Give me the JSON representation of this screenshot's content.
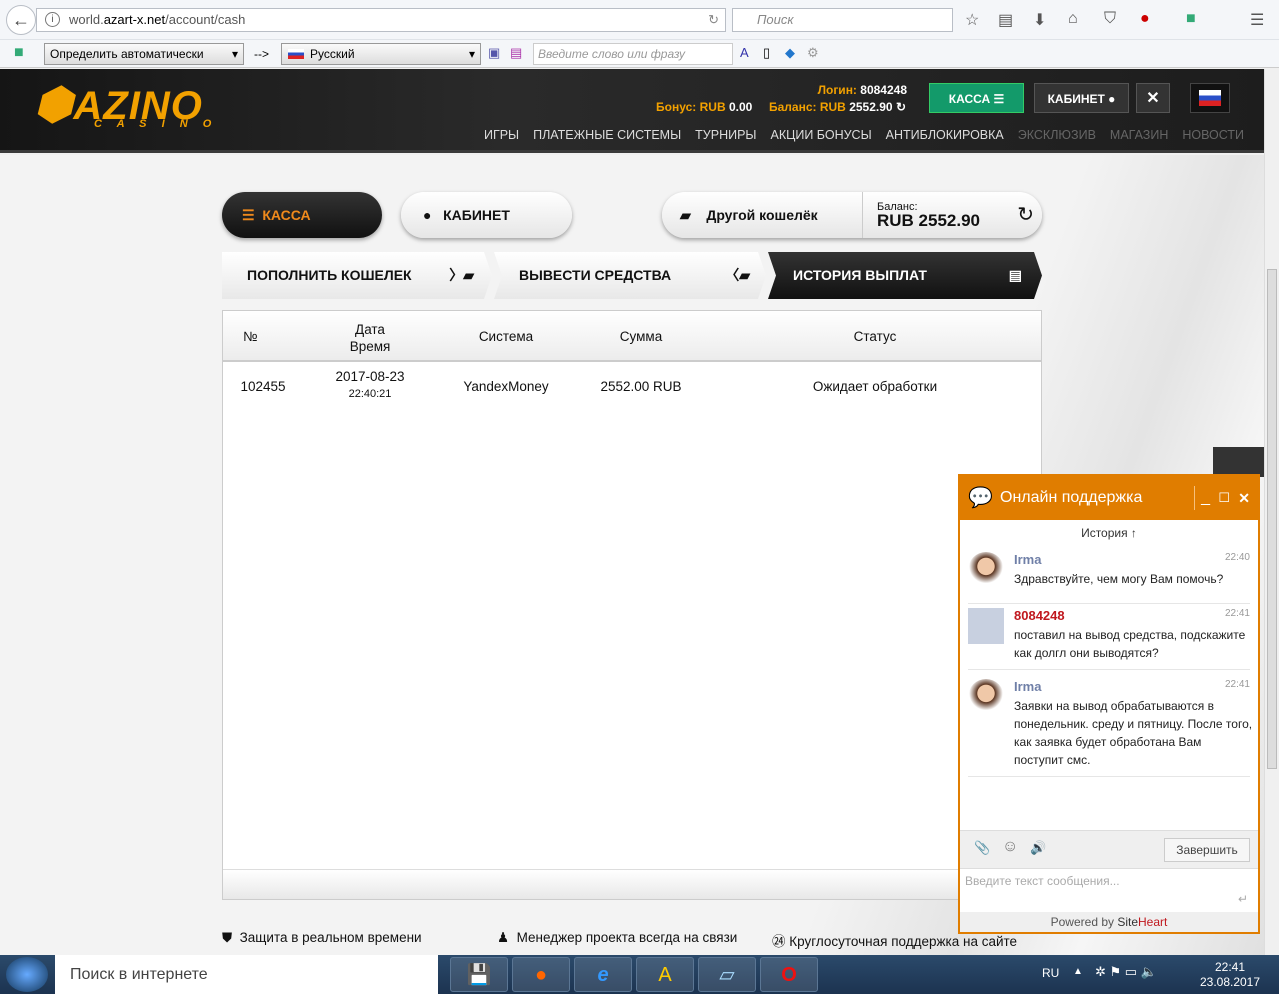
{
  "browser": {
    "url_prefix": "world.",
    "url_domain": "azart-x.net",
    "url_path": "/account/cash",
    "search_placeholder": "Поиск",
    "translate_from": "Определить автоматически",
    "arrow": "-->",
    "translate_to": "Русский",
    "translate_placeholder": "Введите слово или фразу"
  },
  "header": {
    "logo_main": "AZINO",
    "logo_sub": "C A S I N O",
    "login_label": "Логин:",
    "login_value": "8084248",
    "bonus_label": "Бонус: RUB",
    "bonus_value": "0.00",
    "balance_label": "Баланс: RUB",
    "balance_value": "2552.90",
    "kassa": "КАССА",
    "cabinet": "КАБИНЕТ",
    "menu": [
      "ИГРЫ",
      "ПЛАТЕЖНЫЕ СИСТЕМЫ",
      "ТУРНИРЫ",
      "АКЦИИ БОНУСЫ",
      "АНТИБЛОКИРОВКА"
    ],
    "menu_dim": [
      "ЭКСКЛЮЗИВ",
      "МАГАЗИН",
      "НОВОСТИ"
    ]
  },
  "page": {
    "kassa": "КАССА",
    "cabinet": "КАБИНЕТ",
    "other_wallet": "Другой кошелёк",
    "balance_label": "Баланс:",
    "balance_value": "RUB 2552.90",
    "tabs": [
      "ПОПОЛНИТЬ КОШЕЛЕК",
      "ВЫВЕСТИ СРЕДСТВА",
      "ИСТОРИЯ ВЫПЛАТ"
    ],
    "columns": [
      "№",
      "Дата",
      "Время",
      "Система",
      "Сумма",
      "Статус"
    ],
    "rows": [
      {
        "id": "102455",
        "date": "2017-08-23",
        "time": "22:40:21",
        "system": "YandexMoney",
        "amount": "2552.00 RUB",
        "status": "Ожидает обработки"
      }
    ],
    "features": [
      "Защита в реальном времени",
      "Менеджер проекта всегда на связи",
      "Круглосуточная поддержка на сайте"
    ]
  },
  "chat": {
    "title": "Онлайн поддержка",
    "history": "История ↑",
    "messages": [
      {
        "name": "Irma",
        "time": "22:40",
        "text": "Здравствуйте, чем могу Вам помочь?"
      },
      {
        "name": "8084248",
        "time": "22:41",
        "text": "поставил на вывод средства, подскажите как долгл они выводятся?"
      },
      {
        "name": "Irma",
        "time": "22:41",
        "text": "Заявки на вывод обрабатываются в понедельник. среду и пятницу. После того, как заявка будет обработана Вам поступит смс."
      }
    ],
    "end_button": "Завершить",
    "input_placeholder": "Введите текст сообщения...",
    "powered_by": "Powered by ",
    "powered_site": "Site",
    "powered_heart": "Heart"
  },
  "taskbar": {
    "search": "Поиск в интернете",
    "lang": "RU",
    "time": "22:41",
    "date": "23.08.2017"
  }
}
